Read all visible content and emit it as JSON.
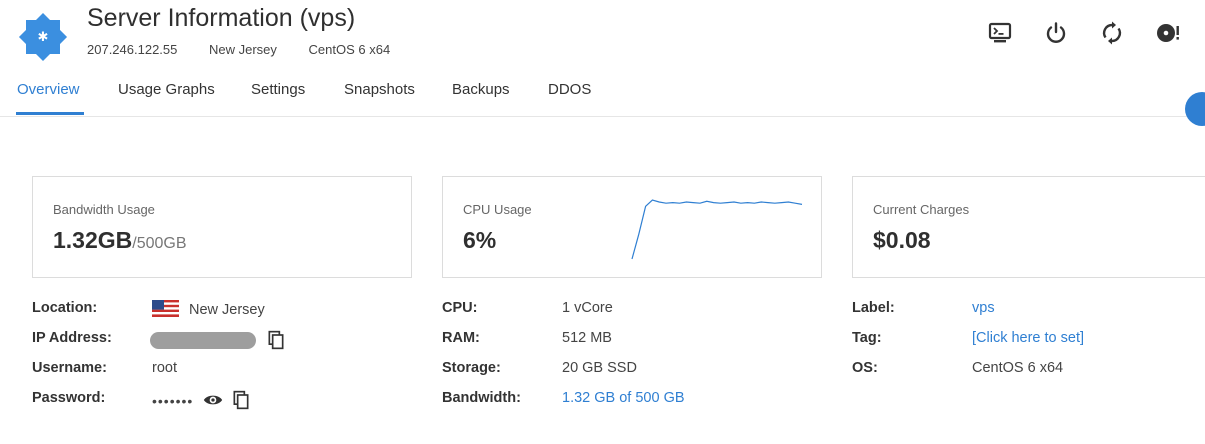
{
  "header": {
    "title": "Server Information (vps)",
    "ip": "207.246.122.55",
    "location": "New Jersey",
    "os": "CentOS 6 x64",
    "actions": [
      {
        "name": "console",
        "icon": "monitor-icon"
      },
      {
        "name": "power",
        "icon": "power-icon"
      },
      {
        "name": "restart",
        "icon": "refresh-icon"
      },
      {
        "name": "reinstall",
        "icon": "disc-alert-icon"
      }
    ]
  },
  "tabs": [
    "Overview",
    "Usage Graphs",
    "Settings",
    "Snapshots",
    "Backups",
    "DDOS"
  ],
  "active_tab": "Overview",
  "cards": {
    "bandwidth": {
      "label": "Bandwidth Usage",
      "value": "1.32GB",
      "total": "/500GB"
    },
    "cpu": {
      "label": "CPU Usage",
      "value": "6%",
      "spark": [
        0,
        40,
        85,
        95,
        92,
        90,
        91,
        90,
        92,
        91,
        90,
        93,
        91,
        90,
        91,
        92,
        90,
        91,
        90,
        92,
        91,
        90,
        91,
        92,
        90,
        88
      ]
    },
    "charges": {
      "label": "Current Charges",
      "value": "$0.08"
    }
  },
  "left_info": {
    "location_label": "Location:",
    "location": "New Jersey",
    "ip_label": "IP Address:",
    "username_label": "Username:",
    "username": "root",
    "password_label": "Password:",
    "password_mask": "•••••••"
  },
  "mid_info": {
    "cpu_label": "CPU:",
    "cpu": "1 vCore",
    "ram_label": "RAM:",
    "ram": "512 MB",
    "storage_label": "Storage:",
    "storage": "20 GB SSD",
    "bandwidth_label": "Bandwidth:",
    "bandwidth": "1.32 GB of 500 GB"
  },
  "right_info": {
    "label_label": "Label:",
    "label": "vps",
    "tag_label": "Tag:",
    "tag": "[Click here to set]",
    "os_label": "OS:",
    "os": "CentOS 6 x64"
  },
  "colors": {
    "accent": "#2f7fd2",
    "logo": "#3b8fe0"
  }
}
